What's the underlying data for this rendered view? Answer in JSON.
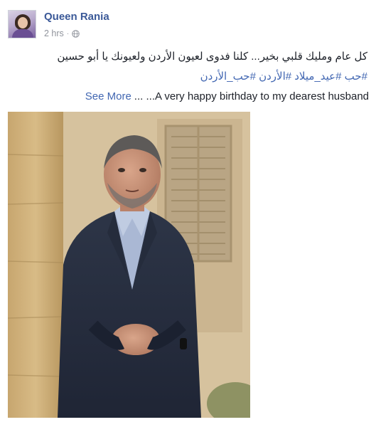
{
  "post": {
    "author": "Queen Rania",
    "time": "2 hrs",
    "separator": "·",
    "privacy_icon": "globe-icon",
    "arabic_line": "كل عام ومليك قلبي بخير... كلنا فدوى لعيون الأردن ولعيونك يا أبو حسين",
    "hashtags": "#حب #عيد_ميلاد #الأردن #حب_الأردن",
    "english_text": "...A very happy birthday to my dearest husband",
    "ellipsis": "...",
    "see_more": "See More"
  },
  "colors": {
    "link": "#4267b2",
    "author": "#3b5998",
    "meta": "#90949c",
    "text": "#1d2129"
  }
}
